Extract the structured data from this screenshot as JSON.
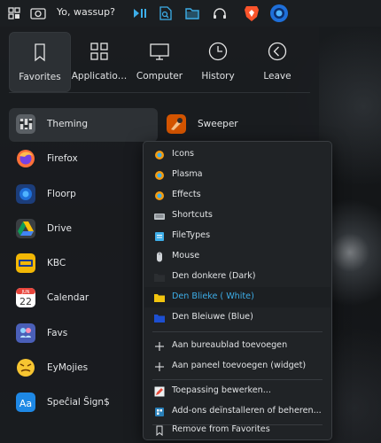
{
  "topbar": {
    "status_text": "Yo, wassup?",
    "icons": [
      "grid-icon",
      "screenshot-icon",
      "media-play-pause-icon",
      "document-search-icon",
      "folder-icon",
      "headphones-icon",
      "brave-browser-icon",
      "floorp-browser-icon"
    ]
  },
  "tabs": [
    {
      "label": "Favorites",
      "icon": "bookmark-icon",
      "active": true
    },
    {
      "label": "Applicatio…",
      "icon": "apps-grid-icon",
      "active": false
    },
    {
      "label": "Computer",
      "icon": "monitor-icon",
      "active": false
    },
    {
      "label": "History",
      "icon": "clock-icon",
      "active": false
    },
    {
      "label": "Leave",
      "icon": "leave-icon",
      "active": false
    }
  ],
  "apps": [
    {
      "label": "Theming",
      "icon": "theming-icon"
    },
    {
      "label": "Sweeper",
      "icon": "sweeper-icon"
    },
    {
      "label": "Firefox",
      "icon": "firefox-icon"
    },
    {
      "label": "Floorp",
      "icon": "floorp-icon"
    },
    {
      "label": "Drive",
      "icon": "google-drive-icon"
    },
    {
      "label": "KBC",
      "icon": "kbc-icon"
    },
    {
      "label": "Calendar",
      "icon": "calendar-icon",
      "calendar_month": "JUN",
      "calendar_day": "22"
    },
    {
      "label": "Favs",
      "icon": "favs-icon"
    },
    {
      "label": "EyMojies",
      "icon": "emoji-icon"
    },
    {
      "label": "Speĉial Ŝign$",
      "icon": "special-signs-icon",
      "glyph": "Aa"
    }
  ],
  "context_menu": {
    "items": [
      {
        "label": "Icons",
        "icon": "icons-app-icon"
      },
      {
        "label": "Plasma",
        "icon": "plasma-app-icon"
      },
      {
        "label": "Effects",
        "icon": "effects-app-icon"
      },
      {
        "label": "Shortcuts",
        "icon": "keyboard-icon"
      },
      {
        "label": "FileTypes",
        "icon": "filetypes-icon"
      },
      {
        "label": "Mouse",
        "icon": "mouse-icon"
      },
      {
        "label": "Den donkere (Dark)",
        "icon": "folder-dark-icon"
      },
      {
        "label": "Den Blieke ( White)",
        "icon": "folder-yellow-icon"
      },
      {
        "label": "Den Bleiuwe (Blue)",
        "icon": "folder-blue-icon"
      },
      {
        "label": "Aan bureaublad toevoegen",
        "icon": "plus-icon"
      },
      {
        "label": "Aan paneel toevoegen (widget)",
        "icon": "plus-icon"
      },
      {
        "label": "Toepassing bewerken...",
        "icon": "edit-app-icon"
      },
      {
        "label": "Add-ons deïnstalleren of beheren...",
        "icon": "addons-icon"
      },
      {
        "label": "Remove from Favorites",
        "icon": "bookmark-remove-icon"
      }
    ]
  }
}
